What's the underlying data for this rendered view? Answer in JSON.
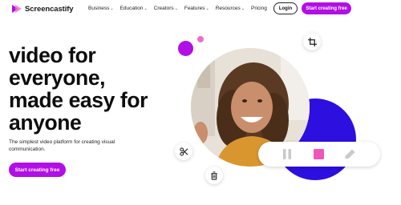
{
  "brand": {
    "name": "Screencastify",
    "accent": "#b10fe6",
    "secondary": "#2d0fe0",
    "pink": "#f06bd0"
  },
  "nav": {
    "items": [
      {
        "label": "Business",
        "has_dropdown": true
      },
      {
        "label": "Education",
        "has_dropdown": true
      },
      {
        "label": "Creators",
        "has_dropdown": true
      },
      {
        "label": "Features",
        "has_dropdown": true
      },
      {
        "label": "Resources",
        "has_dropdown": true
      },
      {
        "label": "Pricing",
        "has_dropdown": false
      }
    ],
    "login_label": "Login",
    "cta_label": "Start creating free"
  },
  "hero": {
    "headline_lines": [
      "video for",
      "everyone,",
      "made easy for",
      "anyone"
    ],
    "subtext": "The simplest video platform for creating visual communication.",
    "cta_label": "Start creating free"
  },
  "illustration": {
    "icons": [
      "crop-icon",
      "scissors-icon",
      "trash-icon",
      "pause-icon",
      "stop-icon",
      "pen-icon"
    ]
  }
}
